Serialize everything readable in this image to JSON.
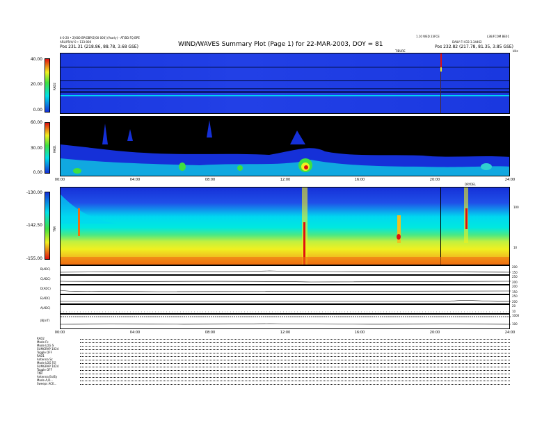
{
  "header": {
    "left_line1": "4-0-20 • 2[000 BP/OBP/2[00 000] (Yearly) - AT/BD FQ BPE",
    "left_line2": "ARL/PR/4/-0 • 133-000",
    "left_pos": "Pos     231.31 (218.86, 88.78, 3.68 GSE)",
    "title": "WIND/WAVES Summary Plot (Page 1) for 22-MAR-2003, DOY = 81",
    "right_line1": "1.10 WED 23FCE",
    "right_line2": "L36/FCOM BE01",
    "right_daily": "DAILY   FI 033   3.34462",
    "right_pos": "Pos     232.82 (217.78, 81.35, 3.85 GSE)",
    "rad_marker": "TIBURE",
    "khz": "kHz"
  },
  "rad2": {
    "label": "RAD2",
    "ticks": [
      "40.00",
      "20.00",
      "0.00"
    ]
  },
  "rad1": {
    "label": "RAD1",
    "ticks": [
      "60.00",
      "30.00",
      "0.00"
    ],
    "xticks": [
      "00:00",
      "04:00",
      "08:00",
      "12:00",
      "16:00",
      "20:00",
      "24:00"
    ],
    "tibure_marker": "DRYDEL"
  },
  "tnr": {
    "label": "TNR",
    "ticks": [
      "-130.00",
      "-142.50",
      "-155.00"
    ],
    "right_ticks": [
      "100",
      "10"
    ]
  },
  "strips": [
    {
      "label": "B(ADC)",
      "right": [
        "200",
        "150"
      ]
    },
    {
      "label": "C(ADC)",
      "right": [
        "250",
        "200"
      ]
    },
    {
      "label": "D(ADC)",
      "right": [
        "200",
        "150"
      ]
    },
    {
      "label": "E(ADC)",
      "right": [
        "250",
        "200"
      ]
    },
    {
      "label": "A(ADC)",
      "right": [
        "20",
        "10"
      ]
    },
    {
      "label": "|B|(nT)",
      "right": [
        "1000",
        "100"
      ]
    }
  ],
  "bottom_xticks": [
    "00:00",
    "04:00",
    "08:00",
    "12:00",
    "16:00",
    "20:00",
    "24:00"
  ],
  "params": [
    {
      "name": "RAD2",
      "value": ""
    },
    {
      "name": "Mode",
      "value": "Fc"
    },
    {
      "name": "Mode",
      "value": "LOG S"
    },
    {
      "name": "SUMGRAP",
      "value": "1024"
    },
    {
      "name": "Toggle",
      "value": "OFF"
    },
    {
      "name": "RAD1",
      "value": ""
    },
    {
      "name": "Antenna",
      "value": "Sc"
    },
    {
      "name": "Mode",
      "value": "LOG [S]"
    },
    {
      "name": "SUMGRAP",
      "value": "1024"
    },
    {
      "name": "Toggle",
      "value": "OFF"
    },
    {
      "name": "TNR",
      "value": ""
    },
    {
      "name": "Antenna",
      "value": "Ex/Ey"
    },
    {
      "name": "Mode",
      "value": "A,D..."
    },
    {
      "name": "Sweeps",
      "value": "ACE..."
    }
  ],
  "colors": {
    "black": "#000000",
    "blue": "#1530d8",
    "cyan": "#00e0e8",
    "green": "#40e040",
    "yellow": "#f0f020",
    "red": "#e01010"
  },
  "chart_data": [
    {
      "type": "heatmap",
      "title": "RAD2",
      "ylim": [
        0,
        40
      ],
      "ylabel": "RAD2",
      "y_ticks": [
        40,
        20,
        0
      ],
      "x_ticks": [
        "00:00",
        "04:00",
        "08:00",
        "12:00",
        "16:00",
        "20:00",
        "24:00"
      ],
      "colorbar": "blue-cyan-green-yellow-red",
      "features": "Mostly blue background with horizontal dark bands; thin cyan band near 2-3; vertical red spike near 20:30"
    },
    {
      "type": "heatmap",
      "title": "RAD1",
      "ylim": [
        0,
        60
      ],
      "ylabel": "RAD1",
      "y_ticks": [
        60,
        30,
        0
      ],
      "x_ticks": [
        "00:00",
        "04:00",
        "08:00",
        "12:00",
        "16:00",
        "20:00",
        "24:00"
      ],
      "colorbar": "blue-cyan-green-yellow-red",
      "features": "Black upper region; blue/cyan activity bursts near bottom; bright red/yellow burst near 12:50"
    },
    {
      "type": "heatmap",
      "title": "TNR",
      "ylim": [
        -155,
        -130
      ],
      "ylabel": "TNR",
      "y_ticks": [
        -130,
        -142.5,
        -155
      ],
      "right_ticks": [
        100,
        10
      ],
      "x_ticks": [
        "00:00",
        "04:00",
        "08:00",
        "12:00",
        "16:00",
        "20:00",
        "24:00"
      ],
      "colorbar": "blue-cyan-green-yellow-red",
      "features": "Blue top, cyan middle, green/yellow/orange bottom; red spikes near 01:00, 12:00, 18:00, 22:30; black vertical line near 20:20"
    }
  ]
}
